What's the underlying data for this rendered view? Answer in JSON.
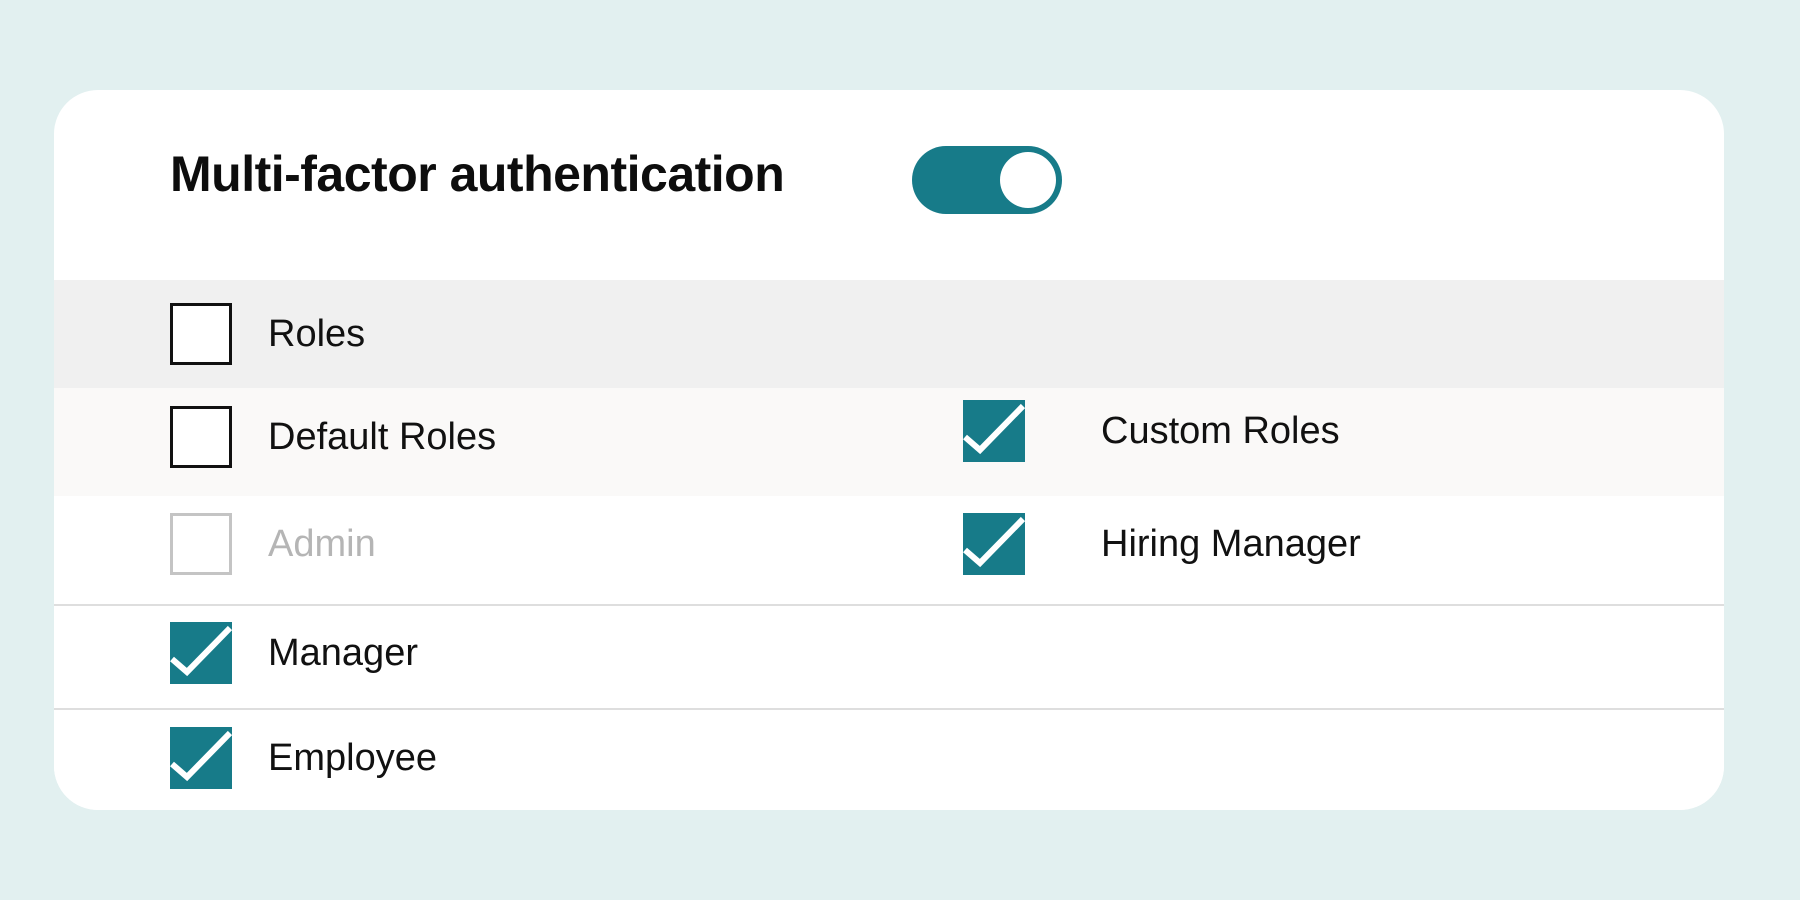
{
  "header": {
    "title": "Multi-factor authentication",
    "toggle_state": "on"
  },
  "roles": {
    "all": {
      "label": "Roles",
      "checked": false
    },
    "default_roles": {
      "label": "Default Roles",
      "checked": false
    },
    "custom_roles": {
      "label": "Custom Roles",
      "checked": true
    },
    "admin": {
      "label": "Admin",
      "checked": false,
      "disabled": true
    },
    "hiring_manager": {
      "label": "Hiring Manager",
      "checked": true
    },
    "manager": {
      "label": "Manager",
      "checked": true
    },
    "employee": {
      "label": "Employee",
      "checked": true
    }
  },
  "colors": {
    "accent": "#177b89",
    "background": "#e2f0f0",
    "card": "#ffffff",
    "roles_row": "#f0f0f0",
    "default_row": "#faf9f8",
    "disabled": "#b5b5b5"
  },
  "icons": {
    "check": "checkmark-icon"
  }
}
